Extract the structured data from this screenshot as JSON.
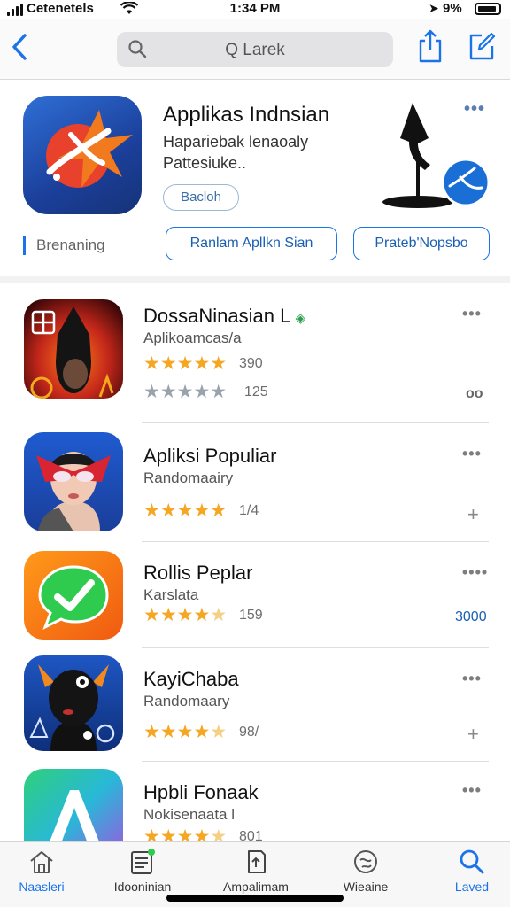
{
  "status_bar": {
    "carrier": "Cetenetels",
    "time": "1:34 PM",
    "battery": "9%",
    "icons": [
      "signal-icon",
      "wifi-icon",
      "location-icon",
      "battery-icon"
    ]
  },
  "nav": {
    "back_icon": "chevron-left-icon",
    "search_text": "Q Larek",
    "share_icon": "share-icon",
    "edit_icon": "compose-icon"
  },
  "featured": {
    "title": "Applikas Indnsian",
    "subtitle_line1": "Hapariebak lenaoaly",
    "subtitle_line2": "Pattesiuke..",
    "button_label": "Bacloh",
    "more_label": "•••",
    "section_label": "Brenaning",
    "pill_1": "Ranlam Apllkn Sian",
    "pill_2": "Prateb'Nopsbo"
  },
  "apps": [
    {
      "name": "DossaNinasian L",
      "category": "Aplikoamcas/a",
      "rating_1": {
        "stars": 5,
        "count": "390"
      },
      "rating_2": {
        "stars": 0,
        "count": "125"
      },
      "side_action": "oo",
      "more": "•••",
      "verified_icon": "diamond-icon"
    },
    {
      "name": "Apliksi Populiar",
      "category": "Randomaairy",
      "rating_1": {
        "stars": 5,
        "count": "1/4"
      },
      "side_action": "+",
      "more": "•••"
    },
    {
      "name": "Rollis Peplar",
      "category": "Karslata",
      "rating_1": {
        "stars": 4.5,
        "count": "159"
      },
      "side_action": "3000",
      "more": "••••"
    },
    {
      "name": "KayiChaba",
      "category": "Randomaary",
      "rating_1": {
        "stars": 4.5,
        "count": "98/"
      },
      "side_action": "+",
      "more": "•••"
    },
    {
      "name": "Hpbli Fonaak",
      "category": "Nokisenaata l",
      "rating_1": {
        "stars": 4.5,
        "count": "801"
      },
      "more": "•••"
    }
  ],
  "tabs": [
    {
      "label": "Naasleri",
      "icon": "home-icon"
    },
    {
      "label": "Idooninian",
      "icon": "news-icon"
    },
    {
      "label": "Ampalimam",
      "icon": "apps-icon"
    },
    {
      "label": "Wieaine",
      "icon": "globe-icon"
    },
    {
      "label": "Laved",
      "icon": "search-icon"
    }
  ],
  "colors": {
    "accent": "#1a73e8",
    "star": "#f5a623",
    "star_off": "#9aa3ad"
  }
}
